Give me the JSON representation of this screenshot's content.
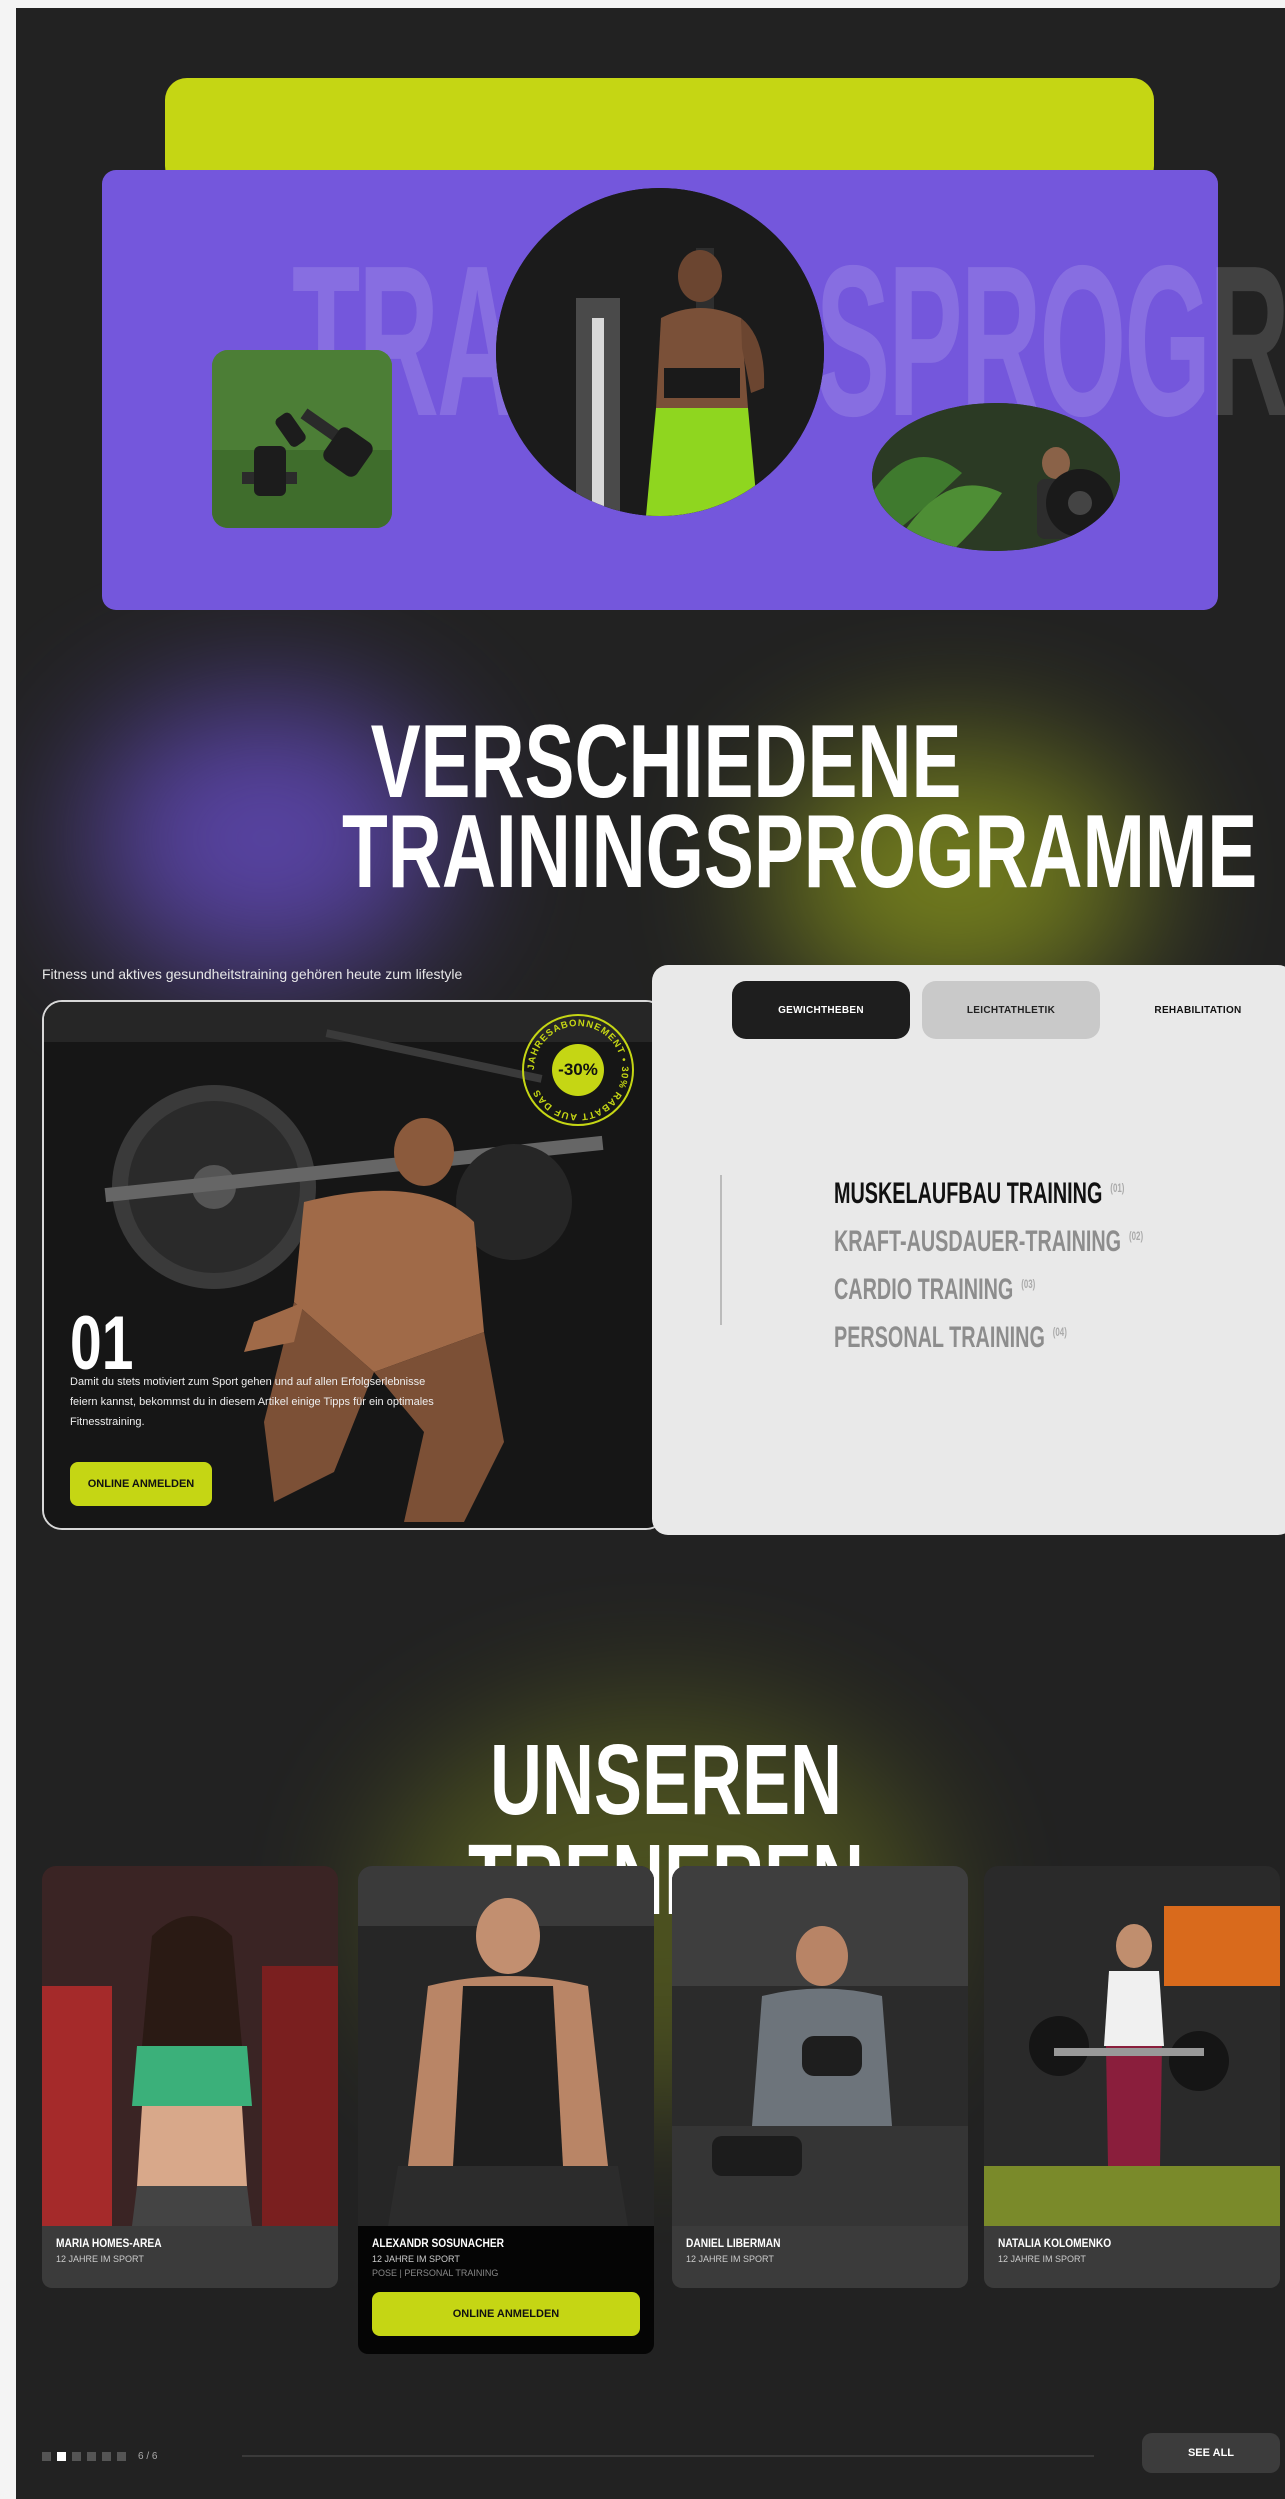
{
  "hero": {
    "ghost_text": "TRAININGSPROGRAMME"
  },
  "section_programs": {
    "title_line1": "VERSCHIEDENE",
    "title_line2": "TRAININGSPROGRAMME",
    "tagline": "Fitness und aktives gesundheitstraining gehören heute zum lifestyle",
    "feature": {
      "number": "01",
      "description": "Damit du stets motiviert zum Sport gehen und auf allen Erfolgserlebnisse feiern kannst, bekommst du in diesem Artikel einige Tipps für ein optimales Fitnesstraining.",
      "button": "ONLINE ANMELDEN",
      "badge_discount": "-30%",
      "badge_ring_text": "JAHRESABONNEMENT • 30% RABATT AUF DAS"
    },
    "tabs": [
      "GEWICHTHEBEN",
      "LEICHTATHLETIK",
      "REHABILITATION"
    ],
    "programs": [
      {
        "label": "MUSKELAUFBAU TRAINING",
        "index": "(01)"
      },
      {
        "label": "KRAFT-AUSDAUER-TRAINING",
        "index": "(02)"
      },
      {
        "label": "CARDIO TRAINING",
        "index": "(03)"
      },
      {
        "label": "PERSONAL TRAINING",
        "index": "(04)"
      }
    ]
  },
  "section_trainers": {
    "title": "UNSEREN TRENEREN",
    "trainers": [
      {
        "name": "MARIA HOMES-AREA",
        "sub": "12 JAHRE IM SPORT"
      },
      {
        "name": "ALEXANDR SOSUNACHER",
        "sub": "12 JAHRE IM SPORT",
        "sub2": "POSE | PERSONAL TRAINING",
        "button": "ONLINE ANMELDEN"
      },
      {
        "name": "DANIEL LIBERMAN",
        "sub": "12 JAHRE IM SPORT"
      },
      {
        "name": "NATALIA KOLOMENKO",
        "sub": "12 JAHRE IM SPORT"
      }
    ],
    "pager": "6 / 6",
    "see_all": "SEE ALL"
  },
  "colors": {
    "accent_lime": "#c5d614",
    "accent_purple": "#7457dc",
    "background": "#222222"
  }
}
